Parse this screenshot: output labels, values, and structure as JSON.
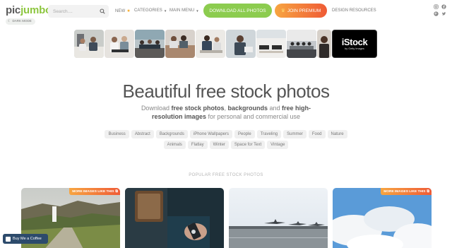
{
  "logo": {
    "text_main": "pic",
    "text_accent": "jumbo"
  },
  "dark_mode": {
    "label": "DARK MODE"
  },
  "search": {
    "placeholder": "Search...."
  },
  "nav": {
    "new_label": "NEW",
    "categories_label": "CATEGORIES",
    "main_menu_label": "MAIN MENU",
    "design_resources_label": "DESIGN RESOURCES"
  },
  "buttons": {
    "download_all": "DOWNLOAD ALL PHOTOS",
    "join_premium": "JOIN PREMIUM"
  },
  "social_icons": [
    "instagram-icon",
    "facebook-icon",
    "pinterest-icon",
    "twitter-icon"
  ],
  "promo_strip": {
    "thumbnails": [
      "office-meeting",
      "women-at-laptop",
      "team-meeting",
      "team-brainstorm",
      "men-at-laptop",
      "man-on-phone",
      "office-desks",
      "conference-room",
      "woman-portrait"
    ],
    "istock": {
      "title": "iStock",
      "subtitle": "by Getty Images"
    }
  },
  "hero": {
    "title": "Beautiful free stock photos",
    "sub_1": "Download ",
    "sub_b1": "free stock photos",
    "sub_2": ", ",
    "sub_b2": "backgrounds",
    "sub_3": " and ",
    "sub_b3": "free high-resolution images",
    "sub_4": " for personal and commercial use"
  },
  "tags": [
    "Business",
    "Abstract",
    "Backgrounds",
    "iPhone Wallpapers",
    "People",
    "Traveling",
    "Summer",
    "Food",
    "Nature",
    "Animals",
    "Flatlay",
    "Winter",
    "Space for Text",
    "Vintage"
  ],
  "popular_heading": "POPULAR FREE STOCK PHOTOS",
  "cards": [
    {
      "name": "waterfall-landscape",
      "badge": "MORE IMAGES LIKE THIS"
    },
    {
      "name": "hands-with-phone",
      "badge": ""
    },
    {
      "name": "airport-planes",
      "badge": ""
    },
    {
      "name": "sky-clouds",
      "badge": "MORE IMAGES LIKE THIS"
    }
  ],
  "coffee": {
    "label": "Buy Me a Coffee"
  },
  "colors": {
    "brand_green": "#8ccc4f",
    "premium_orange": "#ef5b35",
    "coffee_navy": "#2d4b6c"
  }
}
